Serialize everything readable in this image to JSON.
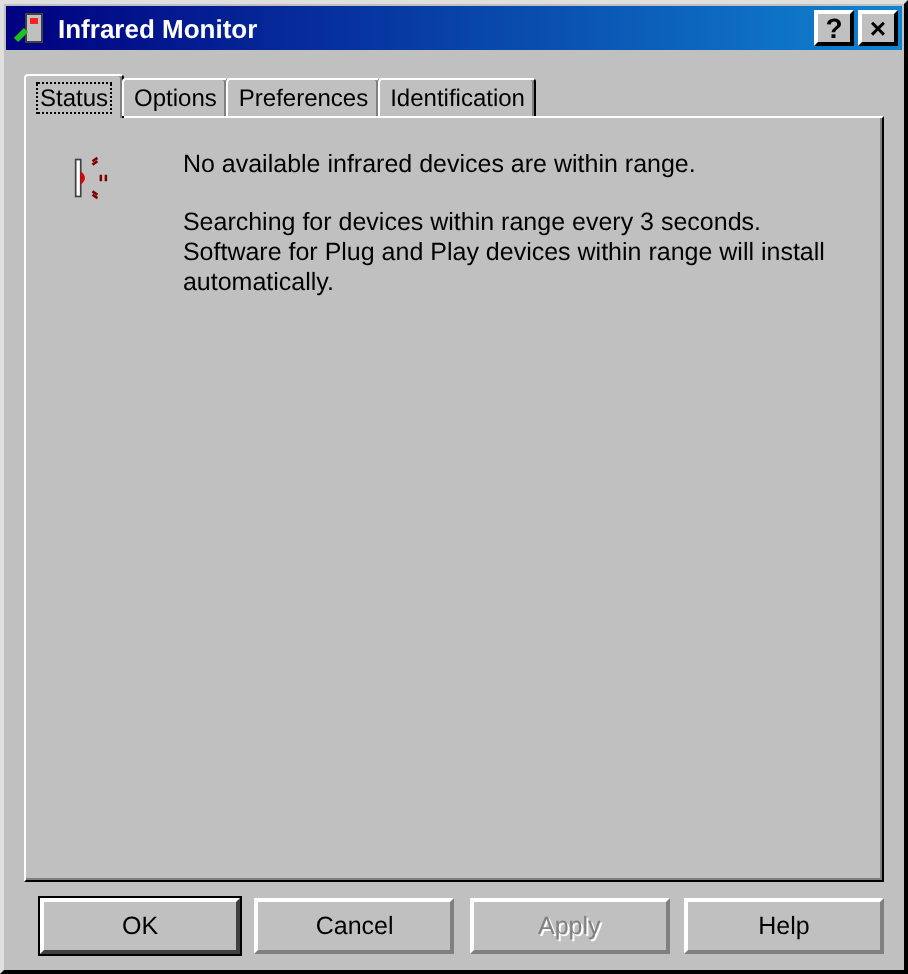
{
  "window": {
    "title": "Infrared Monitor"
  },
  "title_buttons": [
    "?",
    "×"
  ],
  "tabs": [
    {
      "label": "Status",
      "selected": true
    },
    {
      "label": "Options",
      "selected": false
    },
    {
      "label": "Preferences",
      "selected": false
    },
    {
      "label": "Identification",
      "selected": false
    }
  ],
  "status": {
    "message": "No available infrared devices are within range.",
    "details": [
      "Searching for devices within range every 3 seconds.",
      "Software for Plug and Play devices within range will install automatically."
    ]
  },
  "buttons": [
    {
      "label": "OK",
      "default": true,
      "disabled": false
    },
    {
      "label": "Cancel",
      "default": false,
      "disabled": false
    },
    {
      "label": "Apply",
      "default": false,
      "disabled": true
    },
    {
      "label": "Help",
      "default": false,
      "disabled": false
    }
  ]
}
